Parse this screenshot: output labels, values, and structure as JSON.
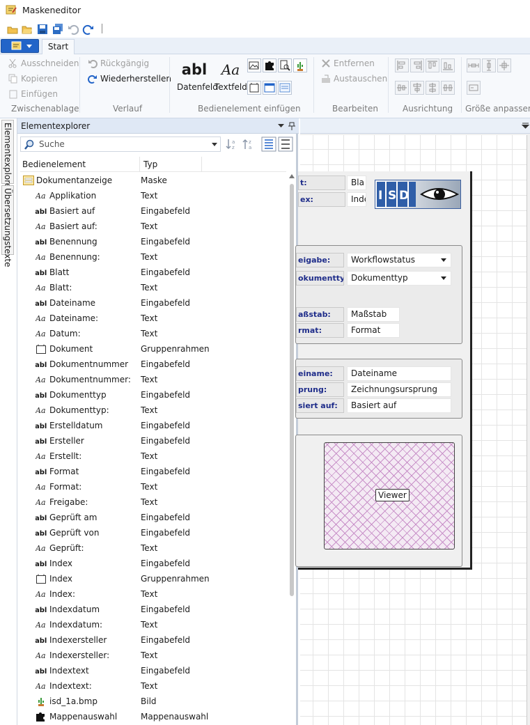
{
  "window": {
    "title": "Maskeneditor"
  },
  "tabs": {
    "start": "Start"
  },
  "ribbon": {
    "clipboard": {
      "cut": "Ausschneiden",
      "copy": "Kopieren",
      "paste": "Einfügen",
      "label": "Zwischenablage"
    },
    "history": {
      "undo": "Rückgängig",
      "redo": "Wiederherstellen",
      "label": "Verlauf"
    },
    "insert": {
      "datafield_glyph": "abl",
      "datafield": "Datenfeld",
      "textfield_glyph": "Aa",
      "textfield": "Textfeld",
      "label": "Bedienelement einfügen"
    },
    "edit": {
      "remove": "Entfernen",
      "replace": "Austauschen",
      "label": "Bearbeiten"
    },
    "align": {
      "label": "Ausrichtung"
    },
    "size": {
      "label": "Größe anpassen"
    }
  },
  "sidetabs": {
    "explorer": "Elementexplorer",
    "translations": "Übersetzungstexte"
  },
  "explorer": {
    "title": "Elementexplorer",
    "search_placeholder": "Suche",
    "col_element": "Bedienelement",
    "col_type": "Typ",
    "root": {
      "name": "Dokumentanzeige",
      "type": "Maske",
      "icon": "mask-icon"
    },
    "rows": [
      {
        "name": "Applikation",
        "type": "Text",
        "icon": "text-icon"
      },
      {
        "name": "Basiert auf",
        "type": "Eingabefeld",
        "icon": "field-icon"
      },
      {
        "name": "Basiert auf:",
        "type": "Text",
        "icon": "text-icon"
      },
      {
        "name": "Benennung",
        "type": "Eingabefeld",
        "icon": "field-icon"
      },
      {
        "name": "Benennung:",
        "type": "Text",
        "icon": "text-icon"
      },
      {
        "name": "Blatt",
        "type": "Eingabefeld",
        "icon": "field-icon"
      },
      {
        "name": "Blatt:",
        "type": "Text",
        "icon": "text-icon"
      },
      {
        "name": "Dateiname",
        "type": "Eingabefeld",
        "icon": "field-icon"
      },
      {
        "name": "Dateiname:",
        "type": "Text",
        "icon": "text-icon"
      },
      {
        "name": "Datum:",
        "type": "Text",
        "icon": "text-icon"
      },
      {
        "name": "Dokument",
        "type": "Gruppenrahmen",
        "icon": "group-icon"
      },
      {
        "name": "Dokumentnummer",
        "type": "Eingabefeld",
        "icon": "field-icon"
      },
      {
        "name": "Dokumentnummer:",
        "type": "Text",
        "icon": "text-icon"
      },
      {
        "name": "Dokumenttyp",
        "type": "Eingabefeld",
        "icon": "field-icon"
      },
      {
        "name": "Dokumenttyp:",
        "type": "Text",
        "icon": "text-icon"
      },
      {
        "name": "Erstelldatum",
        "type": "Eingabefeld",
        "icon": "field-icon"
      },
      {
        "name": "Ersteller",
        "type": "Eingabefeld",
        "icon": "field-icon"
      },
      {
        "name": "Erstellt:",
        "type": "Text",
        "icon": "text-icon"
      },
      {
        "name": "Format",
        "type": "Eingabefeld",
        "icon": "field-icon"
      },
      {
        "name": "Format:",
        "type": "Text",
        "icon": "text-icon"
      },
      {
        "name": "Freigabe:",
        "type": "Text",
        "icon": "text-icon"
      },
      {
        "name": "Geprüft am",
        "type": "Eingabefeld",
        "icon": "field-icon"
      },
      {
        "name": "Geprüft von",
        "type": "Eingabefeld",
        "icon": "field-icon"
      },
      {
        "name": "Geprüft:",
        "type": "Text",
        "icon": "text-icon"
      },
      {
        "name": "Index",
        "type": "Eingabefeld",
        "icon": "field-icon"
      },
      {
        "name": "Index",
        "type": "Gruppenrahmen",
        "icon": "group-icon"
      },
      {
        "name": "Index:",
        "type": "Text",
        "icon": "text-icon"
      },
      {
        "name": "Indexdatum",
        "type": "Eingabefeld",
        "icon": "field-icon"
      },
      {
        "name": "Indexdatum:",
        "type": "Text",
        "icon": "text-icon"
      },
      {
        "name": "Indexersteller",
        "type": "Eingabefeld",
        "icon": "field-icon"
      },
      {
        "name": "Indexersteller:",
        "type": "Text",
        "icon": "text-icon"
      },
      {
        "name": "Indextext",
        "type": "Eingabefeld",
        "icon": "field-icon"
      },
      {
        "name": "Indextext:",
        "type": "Text",
        "icon": "text-icon"
      },
      {
        "name": "isd_1a.bmp",
        "type": "Bild",
        "icon": "image-icon"
      },
      {
        "name": "Mappenauswahl",
        "type": "Mappenauswahl",
        "icon": "puzzle-icon"
      }
    ]
  },
  "mask": {
    "top_fields": [
      {
        "label": "t:",
        "value": "Bla"
      },
      {
        "label": "ex:",
        "value": "Inde"
      }
    ],
    "group1": [
      {
        "label": "eigabe:",
        "value": "Workflowstatus",
        "dropdown": true
      },
      {
        "label": "okumenttyp:",
        "value": "Dokumenttyp",
        "dropdown": true
      },
      {
        "label": "aßstab:",
        "value": "Maßstab",
        "dropdown": false
      },
      {
        "label": "rmat:",
        "value": "Format",
        "dropdown": false
      }
    ],
    "group2": [
      {
        "label": "einame:",
        "value": "Dateiname"
      },
      {
        "label": "prung:",
        "value": "Zeichnungsursprung"
      },
      {
        "label": "siert auf:",
        "value": "Basiert auf"
      }
    ],
    "viewer_label": "Viewer",
    "logo_letters": [
      "I",
      "S",
      "D"
    ]
  },
  "colors": {
    "accent": "#2264c8",
    "label_text": "#1f2d8a",
    "panel_header": "#dfe8f5"
  }
}
